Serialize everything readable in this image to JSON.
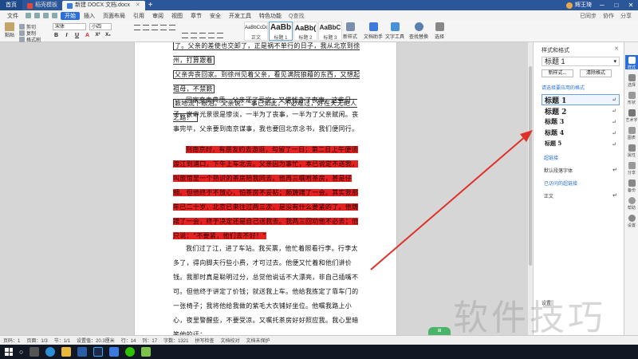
{
  "titlebar": {
    "home": "首页",
    "tabs": [
      {
        "label": "稻壳模板",
        "color": "#e0483a"
      },
      {
        "label": "新建 DOCX 文档.docx",
        "color": "#3b7be0"
      }
    ],
    "user": "辉王琦"
  },
  "menu": {
    "file": "文件",
    "items": [
      "开始",
      "插入",
      "页面布局",
      "引用",
      "审阅",
      "视图",
      "章节",
      "安全",
      "开发工具",
      "特色功能"
    ],
    "active": "开始",
    "search": "Q查找",
    "right": [
      "已同步",
      "协作",
      "分享"
    ]
  },
  "ribbon": {
    "paste": "粘贴",
    "cut": "剪切",
    "copy": "复制",
    "format_painter": "格式刷",
    "font": "宋体",
    "font_size": "小四",
    "format_buttons": [
      "B",
      "I",
      "U",
      "A",
      "X²",
      "X₂"
    ],
    "styles": [
      {
        "preview": "AaBbCcDd",
        "label": "正文"
      },
      {
        "preview": "AaBb",
        "label": "标题 1"
      },
      {
        "preview": "AaBb(",
        "label": "标题 2"
      },
      {
        "preview": "AaBbC",
        "label": "标题 3"
      }
    ],
    "new_style": "新样式",
    "doc_helper": "文档助手",
    "text_tools": "文字工具",
    "find_replace": "查找替换",
    "select": "选择"
  },
  "document": {
    "paragraphs": [
      {
        "lines": [
          "了。父亲的差使也交卸了，正是祸不单行的日子，我从北京到徐州，打算跟着",
          "父亲奔丧回家。到徐州见着父亲，看见满院狼藉的东西，又想起祖母，不禁簌",
          "簌地流下眼泪。父亲说：“事已如此，不必难过，好在天无绝人之路！”"
        ],
        "style": "boxed"
      },
      {
        "text": "回家变卖典质，父亲还了亏空；又借钱办了丧事。这些日子，家中光景很是惨淡，一半为了丧事，一半为了父亲赋闲。丧事完毕，父亲要到南京谋事，我也要回北京念书，我们便同行。",
        "style": "normal"
      },
      {
        "text": "到南京时，有朋友约去游逛，勾留了一日；第二日上午便须渡江到浦口，下午上车北去。父亲因为事忙，本已说定不送我，叫旅馆里一个熟识的茶房陪我同去。他再三嘱咐茶房，甚是仔细。但他终于不放心，怕茶房不妥帖；颇踌躇了一会。其实我那年已二十岁，北京已来往过两三次，是没有什么要紧的了。他踌躇了一会，终于决定还是自己送我去。我两三回劝他不必去；他只说：“不要紧，他们去不好！”",
        "style": "highlight"
      },
      {
        "text": "我们过了江，进了车站。我买票，他忙着照看行李。行李太多了，得向脚夫行些小费，才可过去。他便又忙着和他们讲价钱。我那时真是聪明过分，总觉他说话不大漂亮，非自己插嘴不可。但他终于讲定了价钱；就送我上车。他给我拣定了靠车门的一张椅子；我将他给我做的紫毛大衣铺好坐位。他嘱我路上小心，夜里警醒些，不要受凉。又嘱托茶房好好照应我。我心里暗笑他的迂；",
        "style": "normal"
      }
    ]
  },
  "pane": {
    "title": "样式和格式",
    "current_style": "标题 1",
    "new_style_btn": "新样式...",
    "clear_btn": "清除格式",
    "section_label": "请选择要应用的格式",
    "headings": [
      "标题 1",
      "标题 2",
      "标题 3",
      "标题 4",
      "标题 5"
    ],
    "items": [
      "超链接",
      "默认段落字体",
      "已访问的超链接",
      "正文"
    ],
    "settings": "设置",
    "return_glyph": "↵"
  },
  "sidebar": {
    "items": [
      "样式",
      "选择",
      "形状",
      "艺术字",
      "图表",
      "属性",
      "分享",
      "备份",
      "帮助",
      "设置"
    ]
  },
  "status": {
    "items": [
      "页码：1",
      "页面：1/3",
      "节：1/1",
      "设置值：20.3厘米",
      "行：14",
      "列：17",
      "字数：1321",
      "拼写检查",
      "文档校对",
      "文档未保护"
    ]
  },
  "float_btn": "更\n多\n功\n能",
  "watermark": "软件技巧",
  "colors": {
    "titlebar": "#2b579a",
    "highlight": "#e52222",
    "accent": "#2b6fd6",
    "arrow": "#e0302a"
  }
}
